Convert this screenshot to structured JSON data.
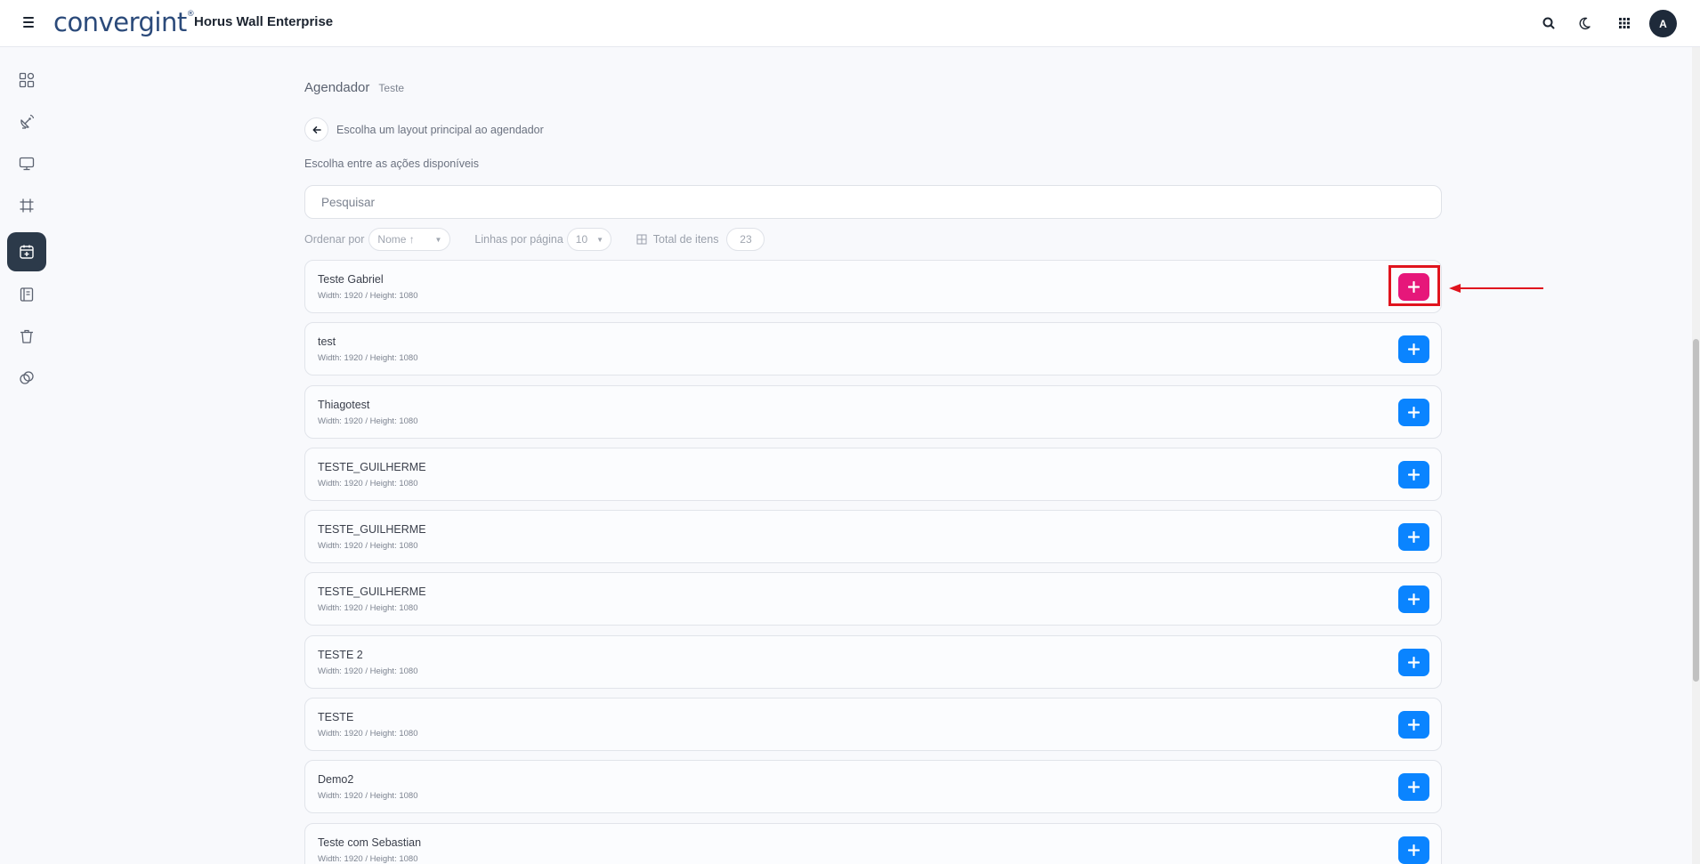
{
  "header": {
    "menu_icon": "hamburger-icon",
    "logo": "convergint",
    "logo_tm": "®",
    "app_title": "Horus Wall Enterprise",
    "icons": [
      "search-icon",
      "moon-icon",
      "apps-grid-icon"
    ],
    "avatar_initial": "A"
  },
  "sidebar": {
    "items": [
      {
        "icon": "dashboard-icon",
        "active": false
      },
      {
        "icon": "satellite-dish-icon",
        "active": false
      },
      {
        "icon": "monitor-icon",
        "active": false
      },
      {
        "icon": "frame-icon",
        "active": false
      },
      {
        "icon": "calendar-plus-icon",
        "active": true
      },
      {
        "icon": "book-icon",
        "active": false
      },
      {
        "icon": "trash-icon",
        "active": false
      },
      {
        "icon": "copy-icon",
        "active": false
      }
    ]
  },
  "breadcrumb": {
    "main": "Agendador",
    "sub": "Teste"
  },
  "back_row": {
    "text": "Escolha um layout principal ao agendador"
  },
  "hint": "Escolha entre as ações disponíveis",
  "search": {
    "placeholder": "Pesquisar",
    "value": ""
  },
  "filters": {
    "sort_label": "Ordenar por",
    "sort_value": "Nome ↑",
    "rows_label": "Linhas por página",
    "rows_value": "10",
    "total_label": "Total de itens",
    "total_value": "23"
  },
  "layouts": [
    {
      "name": "Teste Gabriel",
      "meta": "Width: 1920 / Height: 1080",
      "highlighted": true
    },
    {
      "name": "test",
      "meta": "Width: 1920 / Height: 1080",
      "highlighted": false
    },
    {
      "name": "Thiagotest",
      "meta": "Width: 1920 / Height: 1080",
      "highlighted": false
    },
    {
      "name": "TESTE_GUILHERME",
      "meta": "Width: 1920 / Height: 1080",
      "highlighted": false
    },
    {
      "name": "TESTE_GUILHERME",
      "meta": "Width: 1920 / Height: 1080",
      "highlighted": false
    },
    {
      "name": "TESTE_GUILHERME",
      "meta": "Width: 1920 / Height: 1080",
      "highlighted": false
    },
    {
      "name": "TESTE 2",
      "meta": "Width: 1920 / Height: 1080",
      "highlighted": false
    },
    {
      "name": "TESTE",
      "meta": "Width: 1920 / Height: 1080",
      "highlighted": false
    },
    {
      "name": "Demo2",
      "meta": "Width: 1920 / Height: 1080",
      "highlighted": false
    },
    {
      "name": "Teste com Sebastian",
      "meta": "Width: 1920 / Height: 1080",
      "highlighted": false
    }
  ],
  "colors": {
    "accent": "#0a84ff",
    "highlight_button": "#e6177a",
    "annotation": "#e0141e",
    "sidebar_active": "#2c3a4a"
  }
}
